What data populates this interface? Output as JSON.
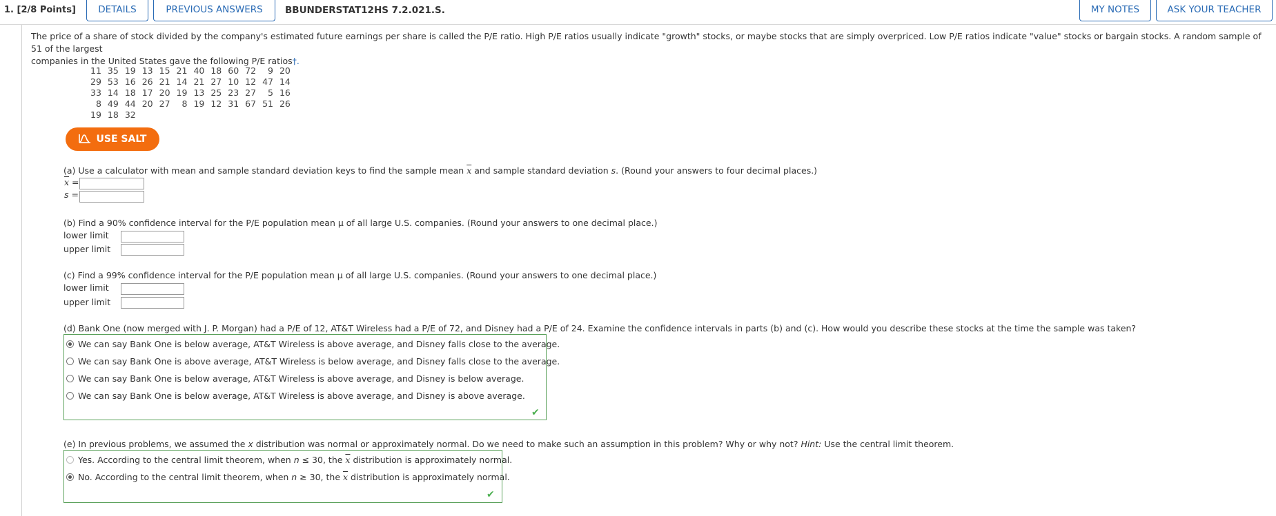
{
  "header": {
    "question_number": "1.",
    "points": "[2/8 Points]",
    "details_label": "DETAILS",
    "previous_answers_label": "PREVIOUS ANSWERS",
    "question_id": "BBUNDERSTAT12HS 7.2.021.S.",
    "my_notes_label": "MY NOTES",
    "ask_teacher_label": "ASK YOUR TEACHER"
  },
  "intro": {
    "line1": "The price of a share of stock divided by the company's estimated future earnings per share is called the P/E ratio. High P/E ratios usually indicate \"growth\" stocks, or maybe stocks that are simply overpriced. Low P/E ratios indicate \"value\" stocks or bargain stocks. A random sample of 51 of the largest",
    "line2": "companies in the United States gave the following P/E ratios",
    "dagger": "†."
  },
  "pe_ratios": [
    [
      "11",
      "35",
      "19",
      "13",
      "15",
      "21",
      "40",
      "18",
      "60",
      "72",
      "9",
      "20"
    ],
    [
      "29",
      "53",
      "16",
      "26",
      "21",
      "14",
      "21",
      "27",
      "10",
      "12",
      "47",
      "14"
    ],
    [
      "33",
      "14",
      "18",
      "17",
      "20",
      "19",
      "13",
      "25",
      "23",
      "27",
      "5",
      "16"
    ],
    [
      "8",
      "49",
      "44",
      "20",
      "27",
      "8",
      "19",
      "12",
      "31",
      "67",
      "51",
      "26"
    ],
    [
      "19",
      "18",
      "32"
    ]
  ],
  "salt_button_label": "USE SALT",
  "part_a": {
    "prompt_start": "(a) Use a calculator with mean and sample standard deviation keys to find the sample mean ",
    "xbar": "x",
    "prompt_mid": " and sample standard deviation ",
    "s": "s",
    "prompt_end": ". (Round your answers to four decimal places.)",
    "xbar_label": "x =",
    "s_label": "s ="
  },
  "part_b": {
    "prompt": "(b) Find a 90% confidence interval for the P/E population mean μ of all large U.S. companies. (Round your answers to one decimal place.)",
    "lower_label": "lower limit",
    "upper_label": "upper limit"
  },
  "part_c": {
    "prompt": "(c) Find a 99% confidence interval for the P/E population mean μ of all large U.S. companies. (Round your answers to one decimal place.)",
    "lower_label": "lower limit",
    "upper_label": "upper limit"
  },
  "part_d": {
    "prompt": "(d) Bank One (now merged with J. P. Morgan) had a P/E of 12, AT&T Wireless had a P/E of 72, and Disney had a P/E of 24. Examine the confidence intervals in parts (b) and (c). How would you describe these stocks at the time the sample was taken?",
    "options": [
      "We can say Bank One is below average, AT&T Wireless is above average, and Disney falls close to the average.",
      "We can say Bank One is above average, AT&T Wireless is below average, and Disney falls close to the average.",
      "We can say Bank One is below average, AT&T Wireless is above average, and Disney is below average.",
      "We can say Bank One is below average, AT&T Wireless is above average, and Disney is above average."
    ],
    "selected_index": 0
  },
  "part_e": {
    "prompt_start": "(e) In previous problems, we assumed the ",
    "x": "x",
    "prompt_mid": " distribution was normal or approximately normal. Do we need to make such an assumption in this problem? Why or why not? ",
    "hint_label": "Hint:",
    "prompt_end": " Use the central limit theorem.",
    "option1_start": "Yes. According to the central limit theorem, when ",
    "option1_n": "n",
    "option1_mid": " ≤ 30, the ",
    "option1_end": " distribution is approximately normal.",
    "option2_start": "No. According to the central limit theorem, when ",
    "option2_n": "n",
    "option2_mid": " ≥ 30, the ",
    "option2_end": " distribution is approximately normal.",
    "selected_index": 1
  },
  "colors": {
    "accent_blue": "#2a6bb5",
    "salt_orange": "#f36d0f",
    "correct_green": "#5aa15a"
  }
}
